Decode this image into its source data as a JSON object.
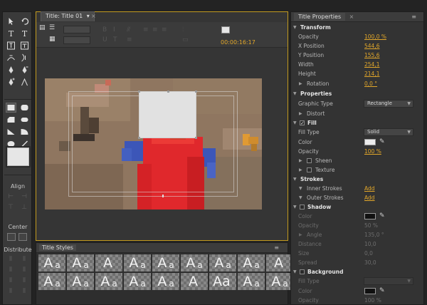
{
  "tabs": {
    "title": "Title: Title 01",
    "properties": "Title Properties",
    "styles": "Title Styles"
  },
  "toolbar": {
    "timecode": "00:00:16:17"
  },
  "tools": {
    "align_label": "Align",
    "center_label": "Center",
    "distribute_label": "Distribute",
    "swatch_color": "#e6e6e6"
  },
  "canvas": {
    "box_color": "#e1e1e1"
  },
  "styles": {
    "samples": [
      {
        "big": "A",
        "small": "a"
      },
      {
        "big": "A",
        "small": "a"
      },
      {
        "big": "A",
        "small": ""
      },
      {
        "big": "A",
        "small": "a"
      },
      {
        "big": "A",
        "small": "a"
      },
      {
        "big": "A",
        "small": "a"
      },
      {
        "big": "A",
        "small": "a"
      },
      {
        "big": "A",
        "small": "a"
      },
      {
        "big": "A",
        "small": ""
      },
      {
        "big": "A",
        "small": "a"
      },
      {
        "big": "A",
        "small": "a"
      },
      {
        "big": "A",
        "small": "a"
      },
      {
        "big": "A",
        "small": "a"
      },
      {
        "big": "A",
        "small": "a"
      },
      {
        "big": "A",
        "small": ""
      },
      {
        "big": "Aa",
        "small": ""
      },
      {
        "big": "A",
        "small": "a"
      },
      {
        "big": "A",
        "small": "a"
      }
    ]
  },
  "properties": {
    "transform": "Transform",
    "opacity": {
      "label": "Opacity",
      "value": "100,0 %"
    },
    "x_position": {
      "label": "X Position",
      "value": "544,6"
    },
    "y_position": {
      "label": "Y Position",
      "value": "155,6"
    },
    "width": {
      "label": "Width",
      "value": "254,1"
    },
    "height": {
      "label": "Height",
      "value": "214,1"
    },
    "rotation": {
      "label": "Rotation",
      "value": "0,0 °"
    },
    "properties_section": "Properties",
    "graphic_type": {
      "label": "Graphic Type",
      "value": "Rectangle"
    },
    "distort": "Distort",
    "fill": "Fill",
    "fill_type": {
      "label": "Fill Type",
      "value": "Solid"
    },
    "color": {
      "label": "Color",
      "swatch": "#ececec"
    },
    "fill_opacity": {
      "label": "Opacity",
      "value": "100 %"
    },
    "sheen": "Sheen",
    "texture": "Texture",
    "strokes": "Strokes",
    "inner_strokes": {
      "label": "Inner Strokes",
      "action": "Add"
    },
    "outer_strokes": {
      "label": "Outer Strokes",
      "action": "Add"
    },
    "shadow": "Shadow",
    "shadow_color": {
      "label": "Color",
      "swatch": "#111111"
    },
    "shadow_opacity": {
      "label": "Opacity",
      "value": "50 %"
    },
    "angle": {
      "label": "Angle",
      "value": "135,0 °"
    },
    "distance": {
      "label": "Distance",
      "value": "10,0"
    },
    "size": {
      "label": "Size",
      "value": "0,0"
    },
    "spread": {
      "label": "Spread",
      "value": "30,0"
    },
    "background": "Background",
    "bg_fill_type": {
      "label": "Fill Type",
      "value": ""
    },
    "bg_color": {
      "label": "Color",
      "swatch": "#111111"
    },
    "bg_opacity": {
      "label": "Opacity",
      "value": "100 %"
    }
  }
}
